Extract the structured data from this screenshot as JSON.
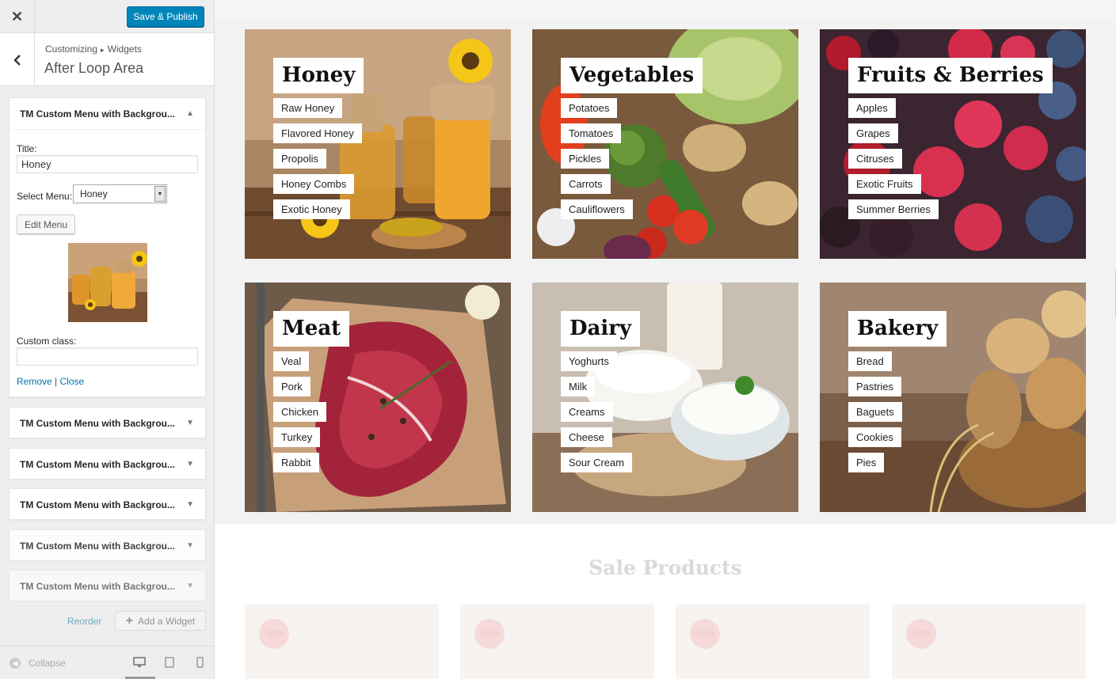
{
  "sidebar": {
    "close_glyph": "✕",
    "save_label": "Save & Publish",
    "breadcrumb": {
      "first": "Customizing",
      "separator": "▸",
      "second": "Widgets"
    },
    "section_title": "After Loop Area",
    "active_widget": {
      "title": "TM Custom Menu with Backgrou...",
      "title_label": "Title:",
      "title_value": "Honey",
      "select_label": "Select Menu:",
      "select_value": "Honey",
      "edit_menu_label": "Edit Menu",
      "custom_class_label": "Custom class:",
      "custom_class_value": "",
      "remove_label": "Remove",
      "link_separator": "|",
      "close_label": "Close"
    },
    "collapsed_widgets": [
      {
        "title": "TM Custom Menu with Backgrou..."
      },
      {
        "title": "TM Custom Menu with Backgrou..."
      },
      {
        "title": "TM Custom Menu with Backgrou..."
      },
      {
        "title": "TM Custom Menu with Backgrou..."
      },
      {
        "title": "TM Custom Menu with Backgrou..."
      }
    ],
    "reorder_label": "Reorder",
    "add_widget_label": "Add a Widget",
    "add_widget_glyph": "+",
    "collapse_label": "Collapse"
  },
  "preview": {
    "cards": [
      {
        "title": "Honey",
        "items": [
          "Raw Honey",
          "Flavored Honey",
          "Propolis",
          "Honey Combs",
          "Exotic Honey"
        ]
      },
      {
        "title": "Vegetables",
        "items": [
          "Potatoes",
          "Tomatoes",
          "Pickles",
          "Carrots",
          "Cauliflowers"
        ]
      },
      {
        "title": "Fruits & Berries",
        "items": [
          "Apples",
          "Grapes",
          "Citruses",
          "Exotic Fruits",
          "Summer Berries"
        ]
      },
      {
        "title": "Meat",
        "items": [
          "Veal",
          "Pork",
          "Chicken",
          "Turkey",
          "Rabbit"
        ]
      },
      {
        "title": "Dairy",
        "items": [
          "Yoghurts",
          "Milk",
          "Creams",
          "Cheese",
          "Sour Cream"
        ]
      },
      {
        "title": "Bakery",
        "items": [
          "Bread",
          "Pastries",
          "Baguets",
          "Cookies",
          "Pies"
        ]
      }
    ],
    "sale_title": "Sale Products",
    "sale_badges": [
      "-30%",
      "-25%",
      "-15%",
      "-10%"
    ]
  },
  "colors": {
    "accent": "#0085ba",
    "link": "#0073aa"
  }
}
